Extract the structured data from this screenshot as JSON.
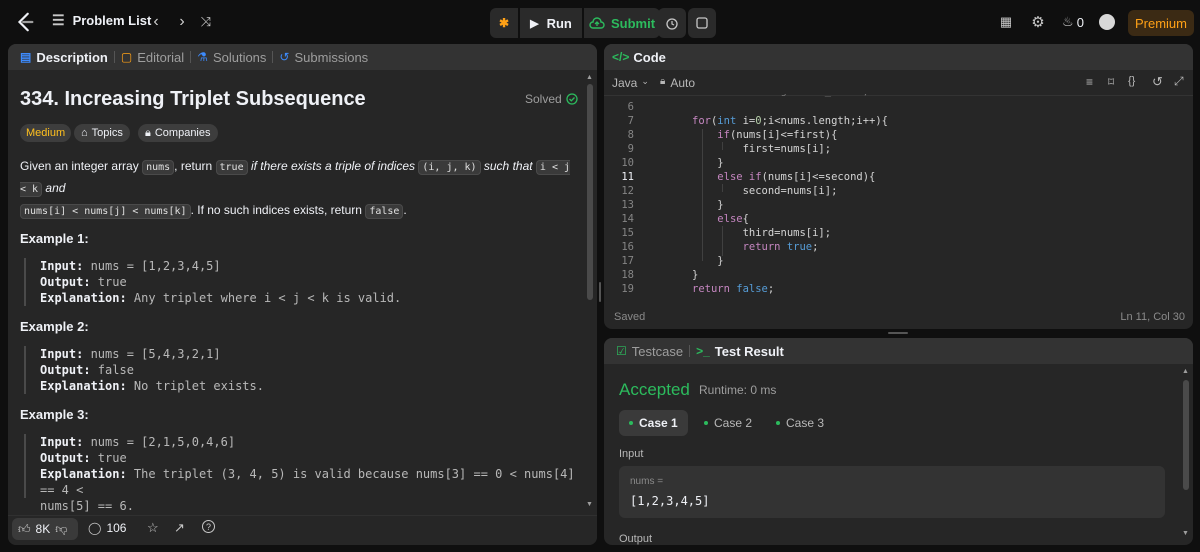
{
  "topbar": {
    "problem_list_label": "Problem List",
    "run_label": "Run",
    "submit_label": "Submit",
    "streak_count": "0",
    "premium_label": "Premium"
  },
  "left": {
    "tabs": [
      {
        "label": "Description"
      },
      {
        "label": "Editorial"
      },
      {
        "label": "Solutions"
      },
      {
        "label": "Submissions"
      }
    ],
    "title": "334. Increasing Triplet Subsequence",
    "solved_label": "Solved",
    "difficulty": "Medium",
    "topics_label": "Topics",
    "companies_label": "Companies",
    "desc": {
      "p1": "Given an integer array ",
      "c1": "nums",
      "p2": ", return ",
      "c2": "true",
      "p3": " if there exists a triple of indices ",
      "c3": "(i, j, k)",
      "p4": " such that ",
      "c4": "i < j < k",
      "p5": " and",
      "c5": "nums[i] < nums[j] < nums[k]",
      "p6": ". If no such indices exists, return ",
      "c6": "false",
      "p7": "."
    },
    "examples": [
      {
        "title": "Example 1:",
        "input_label": "Input:",
        "input": " nums = [1,2,3,4,5]",
        "output_label": "Output:",
        "output": " true",
        "expl_label": "Explanation:",
        "expl": " Any triplet where i < j < k is valid."
      },
      {
        "title": "Example 2:",
        "input_label": "Input:",
        "input": " nums = [5,4,3,2,1]",
        "output_label": "Output:",
        "output": " false",
        "expl_label": "Explanation:",
        "expl": " No triplet exists."
      },
      {
        "title": "Example 3:",
        "input_label": "Input:",
        "input": " nums = [2,1,5,0,4,6]",
        "output_label": "Output:",
        "output": " true",
        "expl_label": "Explanation:",
        "expl": " The triplet (3, 4, 5) is valid because nums[3] == 0 < nums[4] == 4 <",
        "expl2": "nums[5] == 6."
      }
    ],
    "footer": {
      "likes": "8K",
      "comments": "106"
    }
  },
  "code": {
    "title": "Code",
    "language": "Java",
    "auto_label": "Auto",
    "saved_label": "Saved",
    "cursor_position": "Ln 11, Col 30",
    "lines": [
      {
        "n": "6",
        "t": ""
      },
      {
        "n": "7",
        "t": "for(int i=0;i<nums.length;i++){"
      },
      {
        "n": "8",
        "t": "    if(nums[i]<=first){"
      },
      {
        "n": "9",
        "t": "        first=nums[i];"
      },
      {
        "n": "10",
        "t": "    }"
      },
      {
        "n": "11",
        "t": "    else if(nums[i]<=second){"
      },
      {
        "n": "12",
        "t": "        second=nums[i];"
      },
      {
        "n": "13",
        "t": "    }"
      },
      {
        "n": "14",
        "t": "    else{"
      },
      {
        "n": "15",
        "t": "        third=nums[i];"
      },
      {
        "n": "16",
        "t": "        return true;"
      },
      {
        "n": "17",
        "t": "    }"
      },
      {
        "n": "18",
        "t": "}"
      },
      {
        "n": "19",
        "t": "return false;"
      }
    ]
  },
  "test": {
    "testcase_label": "Testcase",
    "result_label": "Test Result",
    "status": "Accepted",
    "runtime": "Runtime: 0 ms",
    "cases": [
      "Case 1",
      "Case 2",
      "Case 3"
    ],
    "input_label": "Input",
    "var_name": "nums =",
    "var_value": "[1,2,3,4,5]",
    "output_label": "Output"
  },
  "colors": {
    "accent": "#ffa116",
    "success": "#2cbb5d",
    "easy": "#ffc01e"
  }
}
